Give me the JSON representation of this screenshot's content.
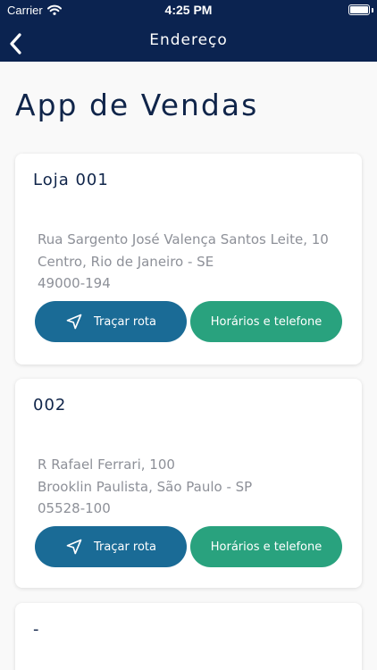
{
  "status_bar": {
    "carrier": "Carrier",
    "time": "4:25 PM"
  },
  "nav": {
    "title": "Endereço"
  },
  "page": {
    "title": "App de Vendas"
  },
  "stores": [
    {
      "name": "Loja 001",
      "address_line1": "Rua Sargento José Valença Santos Leite, 10",
      "address_line2": "Centro, Rio de Janeiro - SE",
      "zip": "49000-194",
      "route_label": "Traçar rota",
      "hours_label": "Horários e telefone"
    },
    {
      "name": "002",
      "address_line1": "R Rafael Ferrari, 100",
      "address_line2": "Brooklin Paulista, São Paulo - SP",
      "zip": "05528-100",
      "route_label": "Traçar rota",
      "hours_label": "Horários e telefone"
    },
    {
      "name": "-"
    }
  ],
  "colors": {
    "nav_bg": "#0b2350",
    "route_button": "#1a6b96",
    "hours_button": "#29a27e"
  }
}
